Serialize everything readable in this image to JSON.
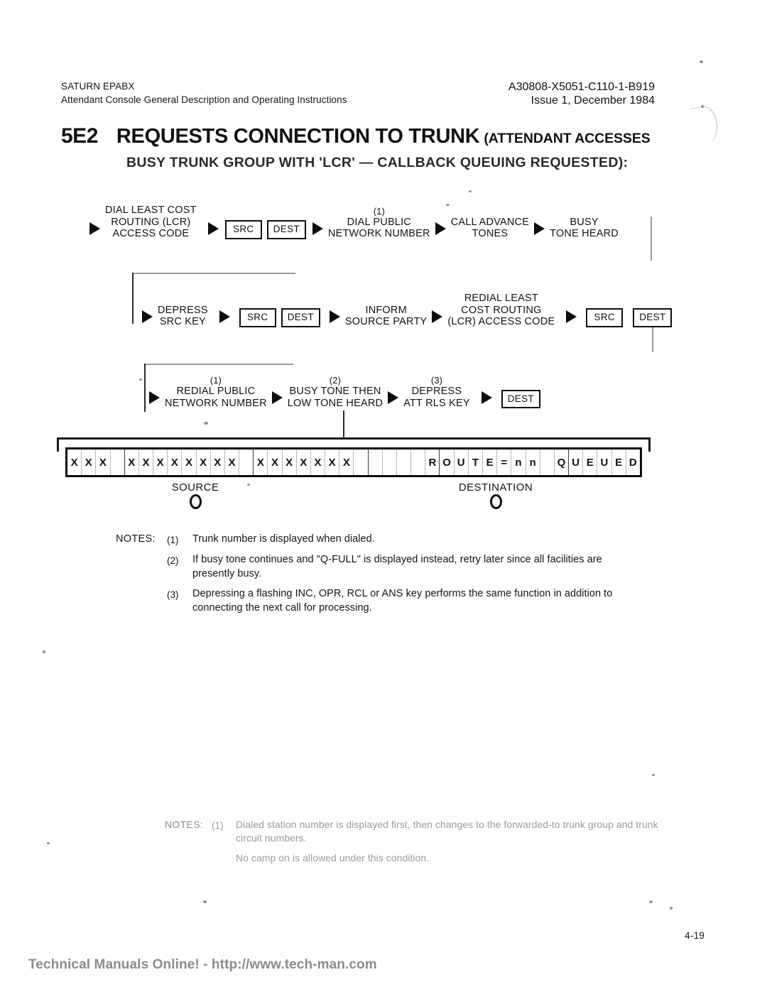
{
  "running_head": {
    "left_line1": "SATURN EPABX",
    "left_line2": "Attendant Console General Description and Operating Instructions",
    "right_line1": "A30808-X5051-C110-1-B919",
    "right_line2": "Issue 1, December 1984"
  },
  "title": {
    "section_number": "5E2",
    "main": "REQUESTS CONNECTION TO TRUNK",
    "paren": "(ATTENDANT ACCESSES",
    "line2": "BUSY TRUNK GROUP WITH 'LCR' — CALLBACK QUEUING REQUESTED):"
  },
  "flow": {
    "row1": {
      "step1": {
        "l1": "DIAL LEAST COST",
        "l2": "ROUTING (LCR)",
        "l3": "ACCESS CODE"
      },
      "keys1": {
        "src": "SRC",
        "dest": "DEST"
      },
      "step2": {
        "ref": "(1)",
        "l1": "DIAL PUBLIC",
        "l2": "NETWORK NUMBER"
      },
      "step3": {
        "l1": "CALL ADVANCE",
        "l2": "TONES"
      },
      "step4": {
        "l1": "BUSY",
        "l2": "TONE HEARD"
      }
    },
    "row2": {
      "step1": {
        "l1": "DEPRESS",
        "l2": "SRC KEY"
      },
      "keys1": {
        "src": "SRC",
        "dest": "DEST"
      },
      "step2": {
        "l1": "INFORM",
        "l2": "SOURCE PARTY"
      },
      "step3": {
        "l1": "REDIAL LEAST",
        "l2": "COST ROUTING",
        "l3": "(LCR) ACCESS CODE"
      },
      "keys2": {
        "src": "SRC",
        "dest": "DEST"
      }
    },
    "row3": {
      "step1": {
        "ref": "(1)",
        "l1": "REDIAL PUBLIC",
        "l2": "NETWORK NUMBER"
      },
      "step2": {
        "ref": "(2)",
        "l1": "BUSY TONE THEN",
        "l2": "LOW TONE HEARD"
      },
      "step3": {
        "ref": "(3)",
        "l1": "DEPRESS",
        "l2": "ATT RLS KEY"
      },
      "keys1": {
        "dest": "DEST"
      }
    }
  },
  "display": {
    "cells": [
      "X",
      "X",
      "X",
      "",
      "X",
      "X",
      "X",
      "X",
      "X",
      "X",
      "X",
      "X",
      "",
      "X",
      "X",
      "X",
      "X",
      "X",
      "X",
      "X",
      "",
      "",
      "",
      "",
      "",
      "R",
      "O",
      "U",
      "T",
      "E",
      "=",
      "n",
      "n",
      "",
      "Q",
      "U",
      "E",
      "U",
      "E",
      "D"
    ],
    "separators": [
      3,
      12,
      20,
      25,
      34
    ],
    "source_label": "SOURCE",
    "destination_label": "DESTINATION"
  },
  "notes": {
    "heading": "NOTES:",
    "items": [
      {
        "num": "(1)",
        "text": "Trunk number is displayed when dialed."
      },
      {
        "num": "(2)",
        "text": "If busy tone continues and \"Q-FULL\" is displayed instead, retry later since all facilities are presently busy."
      },
      {
        "num": "(3)",
        "text": "Depressing a flashing INC, OPR, RCL or ANS key performs the same function in addition to connecting the next call for processing."
      }
    ]
  },
  "ghost_notes": {
    "heading": "NOTES:",
    "num": "(1)",
    "text": "Dialed station number is displayed first, then changes to the forwarded-to trunk group and trunk circuit numbers.",
    "text2": "No camp on is allowed under this condition."
  },
  "footer": {
    "page_number": "4-19",
    "watermark": "Technical Manuals Online! - http://www.tech-man.com"
  }
}
